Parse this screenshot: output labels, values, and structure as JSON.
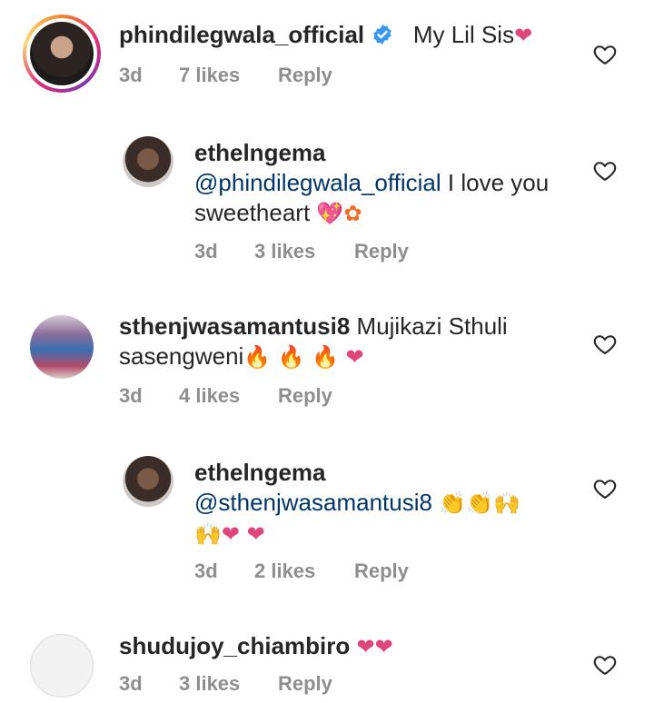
{
  "comments": [
    {
      "username": "phindilegwala_official",
      "text": "My Lil Sis",
      "time": "3d",
      "likes": "7 likes",
      "reply": "Reply"
    },
    {
      "username": "ethelngema",
      "mention": "@phindilegwala_official",
      "text": " I love you sweetheart",
      "time": "3d",
      "likes": "3 likes",
      "reply": "Reply"
    },
    {
      "username": "sthenjwasamantusi8",
      "text": " Mujikazi Sthuli sasengweni",
      "time": "3d",
      "likes": "4 likes",
      "reply": "Reply"
    },
    {
      "username": "ethelngema",
      "mention": "@sthenjwasamantusi8",
      "time": "3d",
      "likes": "2 likes",
      "reply": "Reply"
    },
    {
      "username": "shudujoy_chiambiro",
      "time": "3d",
      "likes": "3 likes",
      "reply": "Reply"
    }
  ],
  "colors": {
    "accent_heart": "#e0457b",
    "mention": "#003569",
    "meta": "#8e8e8e",
    "verified": "#3897f0"
  },
  "icons": [
    "verified-badge-icon",
    "like-heart-icon",
    "pink-heart-emoji",
    "fire-emoji",
    "clap-emoji",
    "raised-hands-emoji",
    "sparkle-heart-emoji",
    "hibiscus-emoji"
  ]
}
